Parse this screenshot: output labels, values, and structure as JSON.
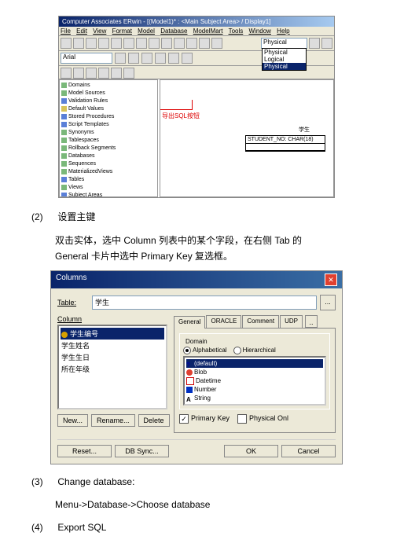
{
  "erwin": {
    "title": "Computer Associates ERwin - [(Model1)* : <Main Subject Area> / Display1]",
    "menu": [
      "File",
      "Edit",
      "View",
      "Format",
      "Model",
      "Database",
      "ModelMart",
      "Tools",
      "Window",
      "Help"
    ],
    "font": "Arial",
    "view_selected": "Physical",
    "view_options": [
      "Physical",
      "Logical",
      "Physical"
    ],
    "tree": [
      "Domains",
      "Model Sources",
      "Validation Rules",
      "Default Values",
      "Stored Procedures",
      "Script Templates",
      "Synonyms",
      "Tablespaces",
      "Rollback Segments",
      "Databases",
      "Sequences",
      "MaterializedViews",
      "Tables",
      "Views",
      "Subject Areas"
    ],
    "sql_note": "导出SQL按钮",
    "entity_title": "学生",
    "entity_field": "STUDENT_NO: CHAR(18)"
  },
  "step2_num": "(2)",
  "step2_title": "设置主键",
  "step2_para": "双击实体，选中 Column 列表中的某个字段，在右侧 Tab 的 General 卡片中选中 Primary Key 复选框。",
  "dlg": {
    "title": "Columns",
    "table_lbl": "Table:",
    "table_val": "学生",
    "column_lbl": "Column",
    "columns": [
      "学生编号",
      "学生姓名",
      "学生生日",
      "所在年级"
    ],
    "tabs": [
      "General",
      "ORACLE",
      "Comment",
      "UDP"
    ],
    "domain_lbl": "Domain",
    "sort_alpha": "Alphabetical",
    "sort_hier": "Hierarchical",
    "domains": [
      "(default)",
      "Blob",
      "Datetime",
      "Number",
      "String"
    ],
    "pk": "Primary Key",
    "phys": "Physical Onl",
    "btn_new": "New...",
    "btn_rename": "Rename...",
    "btn_delete": "Delete",
    "btn_reset": "Reset...",
    "btn_dbsync": "DB Sync...",
    "btn_ok": "OK",
    "btn_cancel": "Cancel"
  },
  "step3_num": "(3)",
  "step3_title": "Change database:",
  "step3_para": "Menu->Database->Choose database",
  "step4_num": "(4)",
  "step4_title": "Export SQL"
}
